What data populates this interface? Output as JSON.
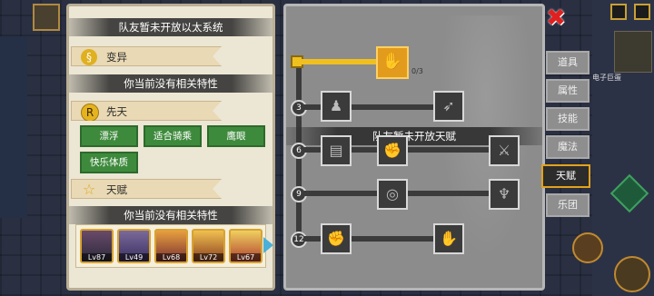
{
  "left_panel": {
    "team_ether_title": "队友暂未开放以太系统",
    "mutation_label": "变异",
    "no_traits_1": "你当前没有相关特性",
    "innate_label": "先天",
    "innate_chips": [
      "漂浮",
      "适合骑乘",
      "鹰眼",
      "快乐体质"
    ],
    "talent_label": "天赋",
    "no_traits_2": "你当前没有相关特性",
    "heroes": [
      {
        "level": "Lv87"
      },
      {
        "level": "Lv49"
      },
      {
        "level": "Lv68"
      },
      {
        "level": "Lv72"
      },
      {
        "level": "Lv67"
      }
    ]
  },
  "right_panel": {
    "root_count": "0/3",
    "team_talent_banner": "队友暂未开放天赋",
    "levels": [
      "3",
      "6",
      "9",
      "12"
    ],
    "watermark": "电子巨蛋"
  },
  "tabs": [
    "道具",
    "属性",
    "技能",
    "魔法",
    "天赋",
    "乐团"
  ],
  "active_tab": "天赋",
  "icons": {
    "close": "close-icon",
    "innate": "r-badge-icon",
    "talent": "star-icon",
    "mutation": "dna-icon"
  }
}
